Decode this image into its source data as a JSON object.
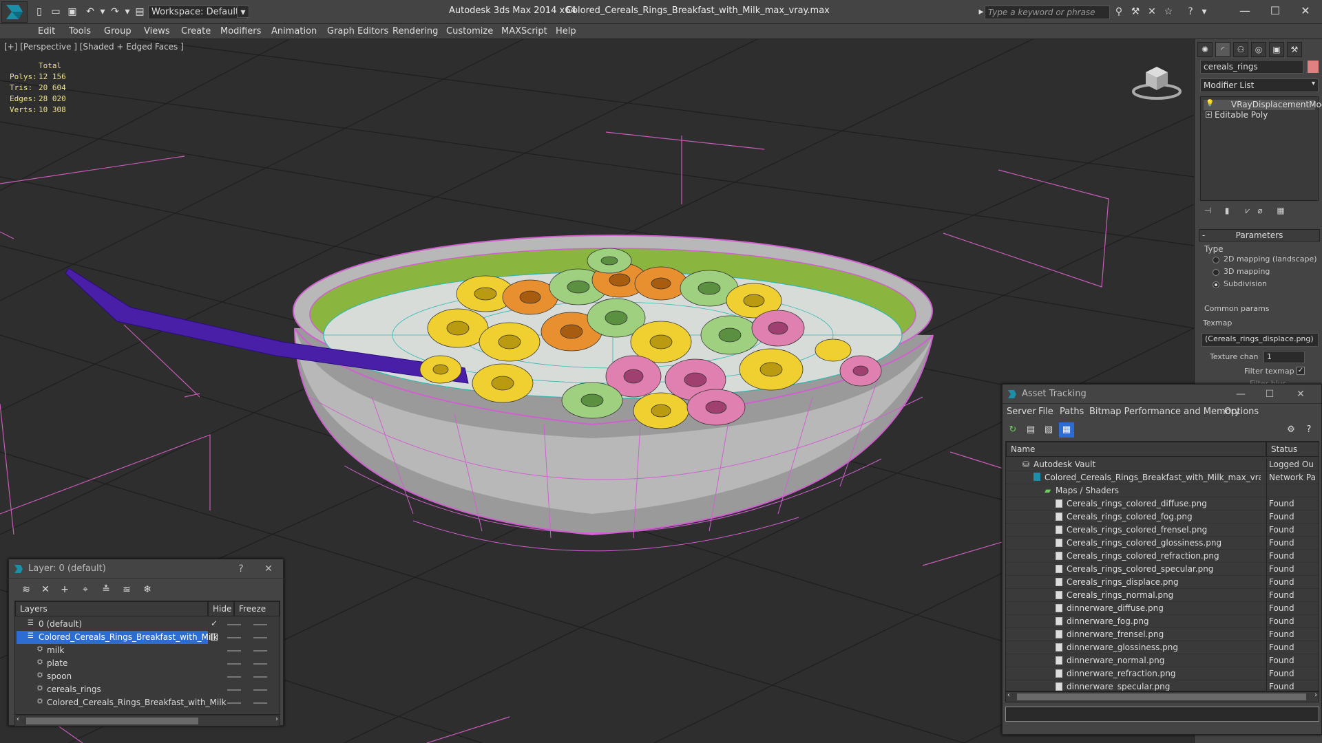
{
  "titlebar": {
    "workspace_label": "Workspace: Default",
    "app_title": "Autodesk 3ds Max  2014 x64",
    "file_title": "Colored_Cereals_Rings_Breakfast_with_Milk_max_vray.max",
    "search_placeholder": "Type a keyword or phrase"
  },
  "menubar": {
    "items": [
      "Edit",
      "Tools",
      "Group",
      "Views",
      "Create",
      "Modifiers",
      "Animation",
      "Graph Editors",
      "Rendering",
      "Customize",
      "MAXScript",
      "Help"
    ]
  },
  "viewport": {
    "label": "[+] [Perspective ] [Shaded + Edged Faces ]",
    "stats": {
      "total_label": "Total",
      "polys_label": "Polys:",
      "polys": "12 156",
      "tris_label": "Tris:",
      "tris": "20 604",
      "edges_label": "Edges:",
      "edges": "28 020",
      "verts_label": "Verts:",
      "verts": "10 308"
    }
  },
  "command_panel": {
    "object_name": "cereals_rings",
    "modifier_list": "Modifier List",
    "stack": [
      "VRayDisplacementMod",
      "Editable Poly"
    ],
    "parameters_label": "Parameters",
    "type_label": "Type",
    "radio_2d": "2D mapping (landscape)",
    "radio_3d": "3D mapping",
    "radio_sub": "Subdivision",
    "common_label": "Common params",
    "texmap_label": "Texmap",
    "texmap_value": "(Cereals_rings_displace.png)",
    "texture_chan_label": "Texture chan",
    "texture_chan_value": "1",
    "filter_texmap_label": "Filter texmap",
    "filter_blur_label": "Filter blur"
  },
  "layer_window": {
    "title": "Layer: 0 (default)",
    "help": "?",
    "col_layers": "Layers",
    "col_hide": "Hide",
    "col_freeze": "Freeze",
    "rows": [
      {
        "name": "0 (default)",
        "level": 1
      },
      {
        "name": "Colored_Cereals_Rings_Breakfast_with_Milk",
        "level": 1,
        "selected": true
      },
      {
        "name": "milk",
        "level": 2
      },
      {
        "name": "plate",
        "level": 2
      },
      {
        "name": "spoon",
        "level": 2
      },
      {
        "name": "cereals_rings",
        "level": 2
      },
      {
        "name": "Colored_Cereals_Rings_Breakfast_with_Milk",
        "level": 2
      }
    ]
  },
  "asset_tracking": {
    "title": "Asset Tracking",
    "menu": [
      "Server",
      "File",
      "Paths",
      "Bitmap Performance and Memory",
      "Options"
    ],
    "col_name": "Name",
    "col_status": "Status",
    "rows": [
      {
        "name": "Autodesk Vault",
        "status": "Logged Ou",
        "level": 1
      },
      {
        "name": "Colored_Cereals_Rings_Breakfast_with_Milk_max_vray.max",
        "status": "Network Pa",
        "level": 2
      },
      {
        "name": "Maps / Shaders",
        "status": "",
        "level": 3
      },
      {
        "name": "Cereals_rings_colored_diffuse.png",
        "status": "Found",
        "level": 4
      },
      {
        "name": "Cereals_rings_colored_fog.png",
        "status": "Found",
        "level": 4
      },
      {
        "name": "Cereals_rings_colored_frensel.png",
        "status": "Found",
        "level": 4
      },
      {
        "name": "Cereals_rings_colored_glossiness.png",
        "status": "Found",
        "level": 4
      },
      {
        "name": "Cereals_rings_colored_refraction.png",
        "status": "Found",
        "level": 4
      },
      {
        "name": "Cereals_rings_colored_specular.png",
        "status": "Found",
        "level": 4
      },
      {
        "name": "Cereals_rings_displace.png",
        "status": "Found",
        "level": 4
      },
      {
        "name": "Cereals_rings_normal.png",
        "status": "Found",
        "level": 4
      },
      {
        "name": "dinnerware_diffuse.png",
        "status": "Found",
        "level": 4
      },
      {
        "name": "dinnerware_fog.png",
        "status": "Found",
        "level": 4
      },
      {
        "name": "dinnerware_frensel.png",
        "status": "Found",
        "level": 4
      },
      {
        "name": "dinnerware_glossiness.png",
        "status": "Found",
        "level": 4
      },
      {
        "name": "dinnerware_normal.png",
        "status": "Found",
        "level": 4
      },
      {
        "name": "dinnerware_refraction.png",
        "status": "Found",
        "level": 4
      },
      {
        "name": "dinnerware_specular.png",
        "status": "Found",
        "level": 4
      }
    ]
  },
  "colors": {
    "selection": "#2d6cd0",
    "wire_pink": "#d060d0",
    "stats_yellow": "#f0e68c"
  }
}
